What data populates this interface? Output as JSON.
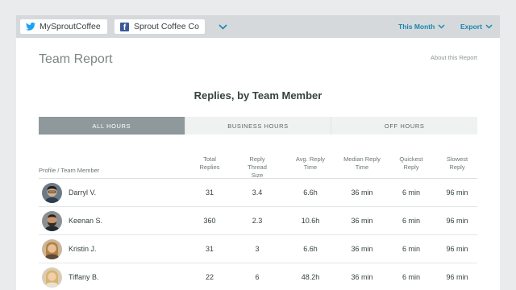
{
  "topbar": {
    "profile_twitter": "MySproutCoffee",
    "profile_facebook": "Sprout Coffee Co",
    "date_range": "This Month",
    "export": "Export"
  },
  "report": {
    "title": "Team Report",
    "about_link": "About this Report",
    "section_title": "Replies, by Team Member"
  },
  "tabs": [
    "ALL HOURS",
    "BUSINESS HOURS",
    "OFF HOURS"
  ],
  "columns": {
    "member": "Profile / Team Member",
    "total_replies": [
      "Total",
      "Replies"
    ],
    "thread_size": [
      "Reply Thread",
      "Size"
    ],
    "avg_time": [
      "Avg. Reply",
      "Time"
    ],
    "median_time": [
      "Median Reply",
      "Time"
    ],
    "quickest": [
      "Quickest",
      "Reply"
    ],
    "slowest": [
      "Slowest",
      "Reply"
    ]
  },
  "rows": [
    {
      "name": "Darryl V.",
      "total": "31",
      "thread": "3.4",
      "avg": "6.6h",
      "median": "36 min",
      "quickest": "6 min",
      "slowest": "96 min"
    },
    {
      "name": "Keenan S.",
      "total": "360",
      "thread": "2.3",
      "avg": "10.6h",
      "median": "36 min",
      "quickest": "6 min",
      "slowest": "96 min"
    },
    {
      "name": "Kristin J.",
      "total": "31",
      "thread": "3",
      "avg": "6.6h",
      "median": "36 min",
      "quickest": "6 min",
      "slowest": "96 min"
    },
    {
      "name": "Tiffany B.",
      "total": "22",
      "thread": "6",
      "avg": "48.2h",
      "median": "36 min",
      "quickest": "6 min",
      "slowest": "96 min"
    }
  ],
  "colors": {
    "accent": "#1c87b3",
    "active_tab": "#8f999c",
    "twitter": "#1da1f2",
    "facebook": "#3b5998"
  },
  "icons": {
    "twitter": "twitter-bird-icon",
    "facebook": "facebook-icon",
    "dropdown": "chevron-down-icon"
  }
}
